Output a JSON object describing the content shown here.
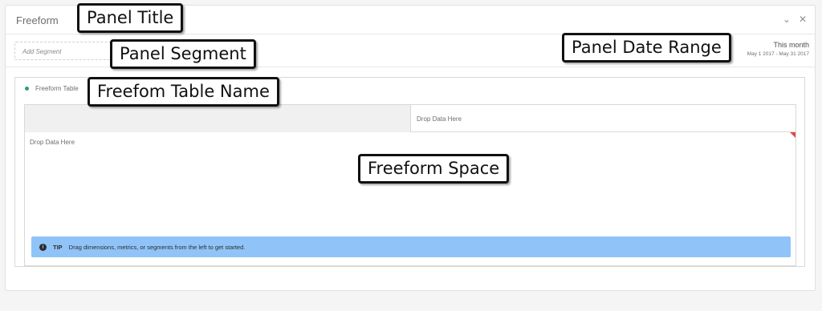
{
  "panel": {
    "title": "Freeform",
    "collapse_icon": "chevron-down-icon",
    "close_icon": "close-icon"
  },
  "segment": {
    "add_segment_placeholder": "Add Segment"
  },
  "date_range": {
    "label": "This month",
    "range": "May 1 2017 - May 31 2017"
  },
  "freeform_table": {
    "name": "Freeform Table",
    "status_color": "#2d9d78",
    "column_drop_text": "Drop Data Here",
    "row_drop_text": "Drop Data Here",
    "tip": {
      "icon": "info-icon",
      "icon_glyph": "i",
      "label": "TIP",
      "text": "Drag dimensions, metrics, or segments from the left to get started."
    }
  },
  "callouts": {
    "panel_title": "Panel Title",
    "panel_segment": "Panel Segment",
    "panel_date_range": "Panel Date Range",
    "freeform_table_name": "Freefom Table Name",
    "freeform_space": "Freeform Space"
  },
  "colors": {
    "tip_background": "#90c4f9",
    "corner_flag": "#e34850"
  }
}
